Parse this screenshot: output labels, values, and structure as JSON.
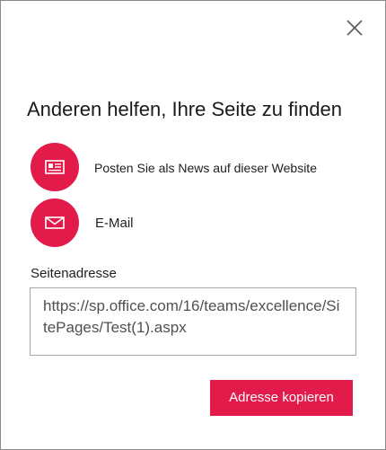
{
  "dialog": {
    "close_icon": "close-icon",
    "title": "Anderen helfen, Ihre Seite zu finden",
    "actions": [
      {
        "icon": "news-icon",
        "label": "Posten Sie als News auf dieser Website"
      },
      {
        "icon": "mail-icon",
        "label": "E-Mail"
      }
    ],
    "address": {
      "label": "Seitenadresse",
      "value": "https://sp.office.com/16/teams/excellence/SitePages/Test(1).aspx"
    },
    "copy_button_label": "Adresse kopieren"
  },
  "colors": {
    "accent": "#e31b4a",
    "text": "#1f1f1f",
    "border": "#8a8a8a"
  }
}
